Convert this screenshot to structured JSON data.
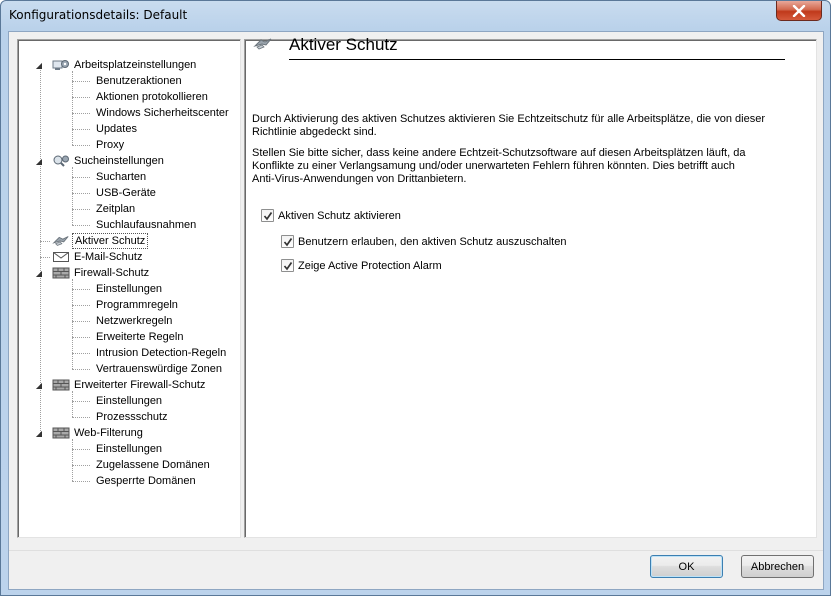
{
  "window": {
    "title": "Konfigurationsdetails: Default"
  },
  "tree": {
    "items": [
      {
        "label": "Arbeitsplatzeinstellungen",
        "level": 0,
        "icon": "workstation-gear-icon",
        "expanded": true
      },
      {
        "label": "Benutzeraktionen",
        "level": 1
      },
      {
        "label": "Aktionen protokollieren",
        "level": 1
      },
      {
        "label": "Windows Sicherheitscenter",
        "level": 1
      },
      {
        "label": "Updates",
        "level": 1
      },
      {
        "label": "Proxy",
        "level": 1
      },
      {
        "label": "Sucheinstellungen",
        "level": 0,
        "icon": "search-gear-icon",
        "expanded": true
      },
      {
        "label": "Sucharten",
        "level": 1
      },
      {
        "label": "USB-Geräte",
        "level": 1
      },
      {
        "label": "Zeitplan",
        "level": 1
      },
      {
        "label": "Suchlaufausnahmen",
        "level": 1
      },
      {
        "label": "Aktiver Schutz",
        "level": 0,
        "icon": "active-protection-icon",
        "selected": true
      },
      {
        "label": "E-Mail-Schutz",
        "level": 0,
        "icon": "envelope-icon"
      },
      {
        "label": "Firewall-Schutz",
        "level": 0,
        "icon": "firewall-icon",
        "expanded": true
      },
      {
        "label": "Einstellungen",
        "level": 1
      },
      {
        "label": "Programmregeln",
        "level": 1
      },
      {
        "label": "Netzwerkregeln",
        "level": 1
      },
      {
        "label": "Erweiterte Regeln",
        "level": 1
      },
      {
        "label": "Intrusion Detection-Regeln",
        "level": 1
      },
      {
        "label": "Vertrauenswürdige Zonen",
        "level": 1
      },
      {
        "label": "Erweiterter Firewall-Schutz",
        "level": 0,
        "icon": "firewall-icon",
        "expanded": true
      },
      {
        "label": "Einstellungen",
        "level": 1
      },
      {
        "label": "Prozessschutz",
        "level": 1
      },
      {
        "label": "Web-Filterung",
        "level": 0,
        "icon": "firewall-icon",
        "expanded": true
      },
      {
        "label": "Einstellungen",
        "level": 1
      },
      {
        "label": "Zugelassene Domänen",
        "level": 1
      },
      {
        "label": "Gesperrte Domänen",
        "level": 1
      }
    ]
  },
  "content": {
    "title": "Aktiver Schutz",
    "para1_line1": "Durch Aktivierung des aktiven Schutzes aktivieren Sie Echtzeitschutz für alle Arbeitsplätze, die von dieser",
    "para1_line2": "Richtlinie abgedeckt sind.",
    "para2_line1": "Stellen Sie bitte sicher, dass keine andere Echtzeit-Schutzsoftware auf diesen Arbeitsplätzen läuft, da",
    "para2_line2": "Konflikte zu einer Verlangsamung und/oder unerwarteten Fehlern führen könnten. Dies betrifft auch",
    "para2_line3": "Anti-Virus-Anwendungen von Drittanbietern.",
    "checkboxes": [
      {
        "label": "Aktiven Schutz aktivieren",
        "checked": true
      },
      {
        "label": "Benutzern erlauben, den aktiven Schutz auszuschalten",
        "checked": true
      },
      {
        "label": "Zeige Active Protection Alarm",
        "checked": true
      }
    ]
  },
  "buttons": {
    "ok": "OK",
    "cancel": "Abbrechen"
  }
}
